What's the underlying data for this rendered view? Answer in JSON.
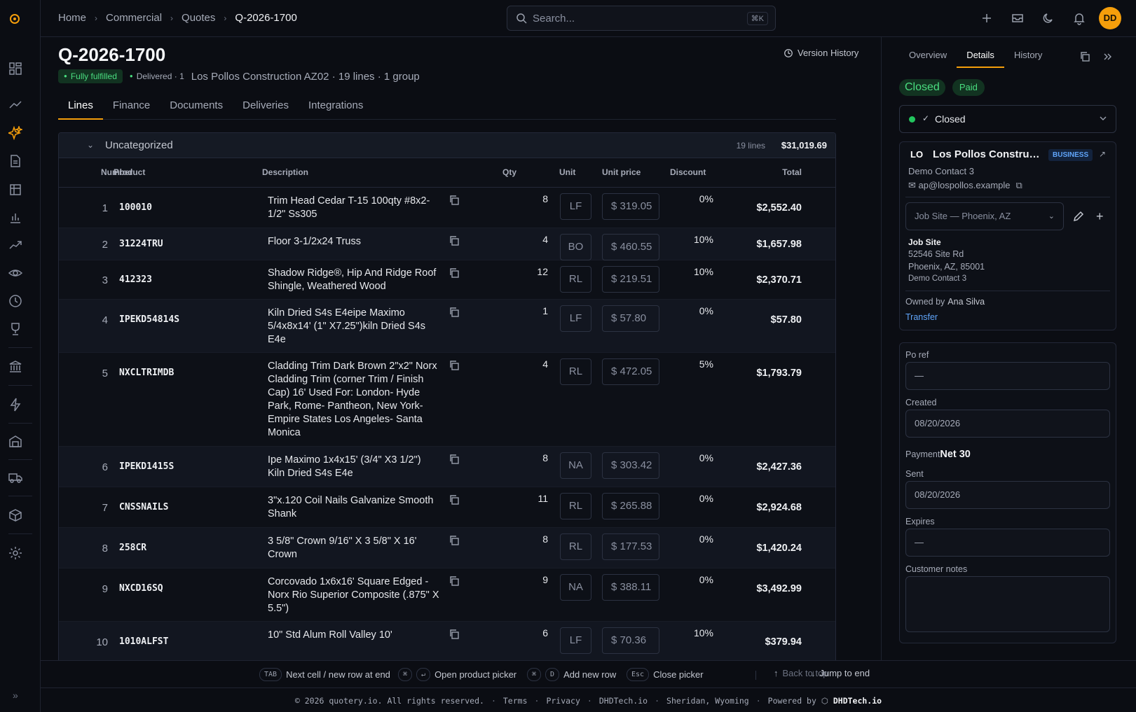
{
  "breadcrumb": [
    "Home",
    "Commercial",
    "Quotes",
    "Q-2026-1700"
  ],
  "search": {
    "placeholder": "Search...",
    "shortcut": "⌘K"
  },
  "user": {
    "initials": "DD"
  },
  "quote": {
    "id": "Q-2026-1700",
    "version_history": "Version History",
    "fulfillment": "Fully fulfilled",
    "delivered": "Delivered · 1",
    "meta": "Los Pollos Construction AZ02 · 19 lines · 1 group"
  },
  "tabs": [
    "Lines",
    "Finance",
    "Documents",
    "Deliveries",
    "Integrations"
  ],
  "group": {
    "name": "Uncategorized",
    "count": "19 lines",
    "total": "$31,019.69"
  },
  "columns": {
    "number": "Number",
    "product": "Product",
    "description": "Description",
    "qty": "Qty",
    "unit": "Unit",
    "unit_price": "Unit price",
    "discount": "Discount",
    "total": "Total"
  },
  "lines": [
    {
      "n": "1",
      "product": "100010",
      "desc": "Trim Head Cedar T-15 100qty #8x2-1/2\" Ss305",
      "qty": "8",
      "unit": "LF",
      "price": "$ 319.05",
      "discount": "0%",
      "total": "$2,552.40"
    },
    {
      "n": "2",
      "product": "31224TRU",
      "desc": "Floor 3-1/2x24 Truss",
      "qty": "4",
      "unit": "BO",
      "price": "$ 460.55",
      "discount": "10%",
      "total": "$1,657.98"
    },
    {
      "n": "3",
      "product": "412323",
      "desc": "Shadow Ridge®, Hip And Ridge Roof Shingle, Weathered Wood",
      "qty": "12",
      "unit": "RL",
      "price": "$ 219.51",
      "discount": "10%",
      "total": "$2,370.71"
    },
    {
      "n": "4",
      "product": "IPEKD54814S",
      "desc": "Kiln Dried S4s E4eipe Maximo 5/4x8x14' (1\" X7.25\")kiln Dried S4s E4e",
      "qty": "1",
      "unit": "LF",
      "price": "$ 57.80",
      "discount": "0%",
      "total": "$57.80"
    },
    {
      "n": "5",
      "product": "NXCLTRIMDB",
      "desc": "Cladding Trim Dark Brown 2\"x2\" Norx Cladding Trim (corner Trim / Finish Cap) 16' Used For: London- Hyde Park, Rome- Pantheon, New York- Empire States Los Angeles- Santa Monica",
      "qty": "4",
      "unit": "RL",
      "price": "$ 472.05",
      "discount": "5%",
      "total": "$1,793.79"
    },
    {
      "n": "6",
      "product": "IPEKD1415S",
      "desc": "Ipe Maximo 1x4x15' (3/4\" X3 1/2\") Kiln Dried S4s E4e",
      "qty": "8",
      "unit": "NA",
      "price": "$ 303.42",
      "discount": "0%",
      "total": "$2,427.36"
    },
    {
      "n": "7",
      "product": "CNSSNAILS",
      "desc": "3\"x.120 Coil Nails Galvanize Smooth Shank",
      "qty": "11",
      "unit": "RL",
      "price": "$ 265.88",
      "discount": "0%",
      "total": "$2,924.68"
    },
    {
      "n": "8",
      "product": "258CR",
      "desc": "3 5/8\" Crown 9/16\" X 3 5/8\" X 16' Crown",
      "qty": "8",
      "unit": "RL",
      "price": "$ 177.53",
      "discount": "0%",
      "total": "$1,420.24"
    },
    {
      "n": "9",
      "product": "NXCD16SQ",
      "desc": "Corcovado 1x6x16' Square Edged - Norx Rio Superior Composite (.875\" X 5.5\")",
      "qty": "9",
      "unit": "NA",
      "price": "$ 388.11",
      "discount": "0%",
      "total": "$3,492.99"
    },
    {
      "n": "10",
      "product": "1010ALFST",
      "desc": "10\" Std Alum Roll Valley 10'",
      "qty": "6",
      "unit": "LF",
      "price": "$ 70.36",
      "discount": "10%",
      "total": "$379.94"
    }
  ],
  "right": {
    "tabs": [
      "Overview",
      "Details",
      "History"
    ],
    "status_badge": "Closed",
    "paid_badge": "Paid",
    "status_select": "Closed",
    "customer": {
      "initials": "LO",
      "name": "Los Pollos Construction AZ02",
      "type": "BUSINESS",
      "contact": "Demo Contact 3",
      "email": "ap@lospollos.example",
      "site_select": "Job Site — Phoenix, AZ",
      "site_title": "Job Site",
      "addr1": "52546 Site Rd",
      "addr2": "Phoenix, AZ, 85001",
      "addr3": "Demo Contact 3",
      "owned_label": "Owned by",
      "owner": "Ana Silva",
      "transfer": "Transfer"
    },
    "form": {
      "po_label": "Po ref",
      "po_value": "—",
      "created_label": "Created",
      "created_value": "08/20/2026",
      "payment_label": "Payment",
      "payment_value": "Net 30",
      "sent_label": "Sent",
      "sent_value": "08/20/2026",
      "expires_label": "Expires",
      "expires_value": "—",
      "notes_label": "Customer notes"
    }
  },
  "shortcuts": {
    "k1": "TAB",
    "t1": "Next cell / new row at end",
    "k2a": "⌘",
    "k2b": "↵",
    "t2": "Open product picker",
    "k3a": "⌘",
    "k3b": "D",
    "t3": "Add new row",
    "k4": "Esc",
    "t4": "Close picker",
    "t5": "Back to top",
    "t6": "Jump to end"
  },
  "footer": {
    "copy": "© 2026 quotery.io. All rights reserved.",
    "terms": "Terms",
    "privacy": "Privacy",
    "site": "DHDTech.io",
    "location": "Sheridan, Wyoming",
    "powered": "Powered by",
    "brand": "DHDTech.io"
  },
  "colors": {
    "accent": "#f59e0b",
    "success": "#4ade80",
    "link": "#60a5fa",
    "bg": "#0b0d13"
  }
}
